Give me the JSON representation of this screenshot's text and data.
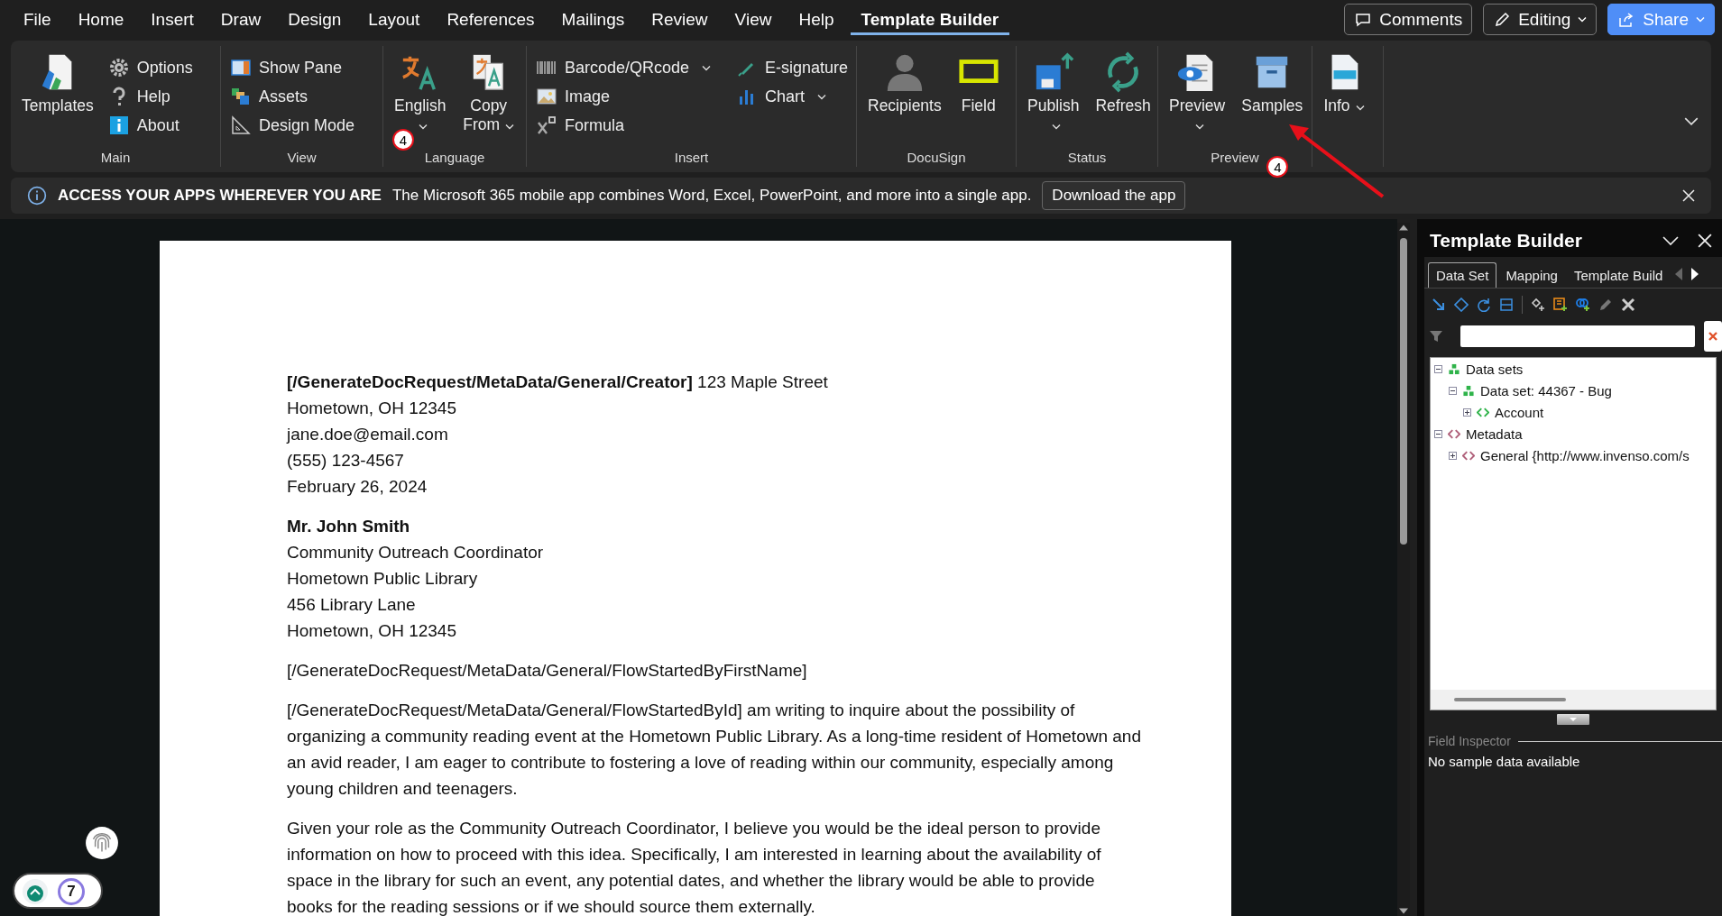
{
  "menu_tabs": [
    {
      "label": "File",
      "selected": false
    },
    {
      "label": "Home",
      "selected": false
    },
    {
      "label": "Insert",
      "selected": false
    },
    {
      "label": "Draw",
      "selected": false
    },
    {
      "label": "Design",
      "selected": false
    },
    {
      "label": "Layout",
      "selected": false
    },
    {
      "label": "References",
      "selected": false
    },
    {
      "label": "Mailings",
      "selected": false
    },
    {
      "label": "Review",
      "selected": false
    },
    {
      "label": "View",
      "selected": false
    },
    {
      "label": "Help",
      "selected": false
    },
    {
      "label": "Template Builder",
      "selected": true
    }
  ],
  "header_buttons": [
    {
      "label": "Comments",
      "kind": "comments",
      "dropdown": false
    },
    {
      "label": "Editing",
      "kind": "editing",
      "dropdown": true
    },
    {
      "label": "Share",
      "kind": "share",
      "dropdown": true
    }
  ],
  "ribbon": {
    "groups": [
      {
        "label": "Main",
        "items": [
          {
            "label": "Templates",
            "kind": "large",
            "dropdown": false
          },
          {
            "label": "Options",
            "kind": "small",
            "dropdown": false
          },
          {
            "label": "Help",
            "kind": "small",
            "dropdown": false
          },
          {
            "label": "About",
            "kind": "small",
            "dropdown": false
          }
        ]
      },
      {
        "label": "View",
        "items": [
          {
            "label": "Show Pane",
            "kind": "small",
            "dropdown": false
          },
          {
            "label": "Assets",
            "kind": "small",
            "dropdown": false
          },
          {
            "label": "Design Mode",
            "kind": "small",
            "dropdown": false
          }
        ]
      },
      {
        "label": "Language",
        "items": [
          {
            "label": "English",
            "kind": "large",
            "dropdown": true,
            "badge": "4"
          },
          {
            "label": "Copy From",
            "kind": "large",
            "dropdown": true
          }
        ]
      },
      {
        "label": "Insert",
        "items": [
          {
            "label": "Barcode/QRcode",
            "kind": "small",
            "dropdown": true
          },
          {
            "label": "Image",
            "kind": "small",
            "dropdown": false
          },
          {
            "label": "Formula",
            "kind": "small",
            "dropdown": false
          },
          {
            "label": "E-signature",
            "kind": "small",
            "dropdown": false
          },
          {
            "label": "Chart",
            "kind": "small",
            "dropdown": true
          }
        ]
      },
      {
        "label": "DocuSign",
        "items": [
          {
            "label": "Recipients",
            "kind": "large",
            "dropdown": false
          },
          {
            "label": "Field",
            "kind": "large",
            "dropdown": false
          }
        ]
      },
      {
        "label": "Status",
        "items": [
          {
            "label": "Publish",
            "kind": "large",
            "dropdown": true
          },
          {
            "label": "Refresh",
            "kind": "large",
            "dropdown": false
          }
        ]
      },
      {
        "label": "Preview",
        "items": [
          {
            "label": "Preview",
            "kind": "large",
            "dropdown": true
          },
          {
            "label": "Samples",
            "kind": "large",
            "dropdown": false,
            "badge": "4"
          }
        ]
      },
      {
        "items": [
          {
            "label": "Info",
            "kind": "large",
            "dropdown": true
          }
        ]
      }
    ]
  },
  "notification": {
    "title": "ACCESS YOUR APPS WHEREVER YOU ARE",
    "message": "The Microsoft 365 mobile app combines Word, Excel, PowerPoint, and more into a single app.",
    "button": "Download the app"
  },
  "document": {
    "paragraphs": [
      {
        "lines": [
          {
            "text": "**[/GenerateDocRequest/MetaData/General/Creator]** 123 Maple Street",
            "bold": false
          },
          {
            "text": "Hometown, OH 12345",
            "bold": false
          },
          {
            "text": "jane.doe@email.com",
            "bold": false
          },
          {
            "text": "(555) 123-4567",
            "bold": false
          },
          {
            "text": "February 26, 2024",
            "bold": false
          }
        ]
      },
      {
        "lines": [
          {
            "text": "Mr. John Smith",
            "bold": true
          },
          {
            "text": "Community Outreach Coordinator",
            "bold": false
          },
          {
            "text": "Hometown Public Library",
            "bold": false
          },
          {
            "text": "456 Library Lane",
            "bold": false
          },
          {
            "text": "Hometown, OH 12345",
            "bold": false
          }
        ]
      },
      {
        "lines": [
          {
            "text": "[/GenerateDocRequest/MetaData/General/FlowStartedByFirstName]",
            "bold": false
          }
        ]
      },
      {
        "lines": [
          {
            "text": "[/GenerateDocRequest/MetaData/General/FlowStartedById] am writing to inquire about the possibility of organizing a community reading event at the Hometown Public Library. As a long-time resident of Hometown and an avid reader, I am eager to contribute to fostering a love of reading within our community, especially among young children and teenagers.",
            "bold": false
          }
        ]
      },
      {
        "lines": [
          {
            "text": "Given your role as the Community Outreach Coordinator, I believe you would be the ideal person to provide information on how to proceed with this idea. Specifically, I am interested in learning about the availability of space in the library for such an event, any potential dates, and whether the library would be able to provide books for the reading sessions or if we should source them externally.",
            "bold": false
          }
        ]
      }
    ]
  },
  "side_panel": {
    "title": "Template Builder",
    "tabs": [
      {
        "label": "Data Set",
        "selected": true
      },
      {
        "label": "Mapping",
        "selected": false
      },
      {
        "label": "Template Build",
        "selected": false
      }
    ],
    "tree": [
      {
        "label": "Data sets",
        "kind": "dataset",
        "expanded": true,
        "children": [
          {
            "label": "Data set: 44367 - Bug",
            "kind": "dataset",
            "expanded": true,
            "children": [
              {
                "label": "Account",
                "kind": "element",
                "expanded": false
              }
            ]
          }
        ]
      },
      {
        "label": "Metadata",
        "kind": "meta",
        "expanded": true,
        "children": [
          {
            "label": "General {http://www.invenso.com/s",
            "kind": "meta",
            "expanded": false
          }
        ]
      }
    ],
    "field_inspector": {
      "title": "Field Inspector",
      "message": "No sample data available"
    }
  },
  "floating_widget": {
    "count": "7"
  }
}
